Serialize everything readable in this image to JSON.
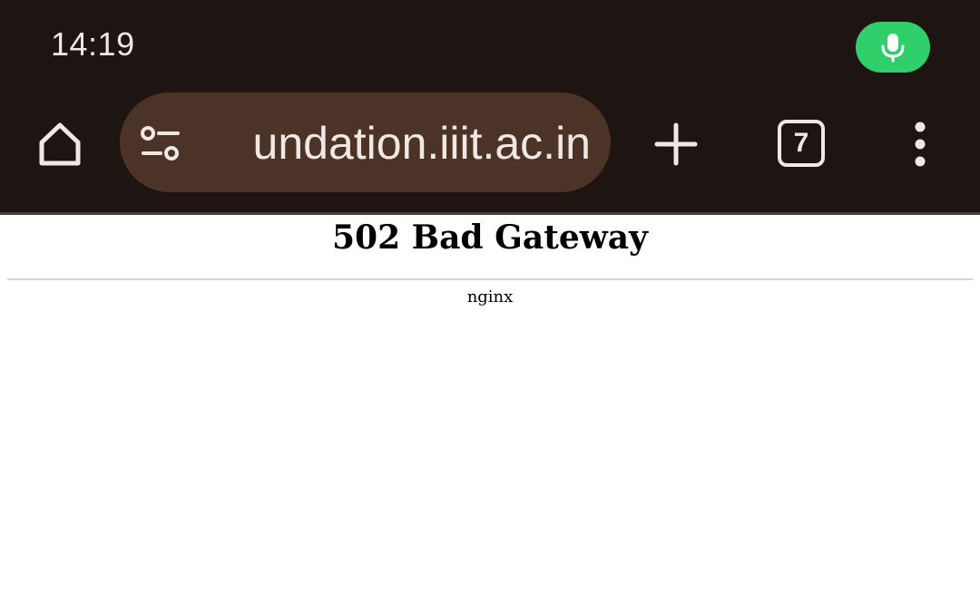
{
  "status_bar": {
    "time": "14:19"
  },
  "toolbar": {
    "url": "undation.iiit.ac.in",
    "tab_count": "7"
  },
  "page": {
    "title": "502 Bad Gateway",
    "server": "nginx"
  },
  "colors": {
    "chrome_background": "#1e1411",
    "omnibox_background": "#4b3328",
    "icon_foreground": "#f1e7e3",
    "mic_accent": "#2fcf6b"
  },
  "icons": {
    "home": "home-icon",
    "site_settings": "tune-icon",
    "new_tab": "plus-icon",
    "tab_switcher": "tab-count-icon",
    "menu": "more-vert-icon",
    "mic": "microphone-icon"
  }
}
